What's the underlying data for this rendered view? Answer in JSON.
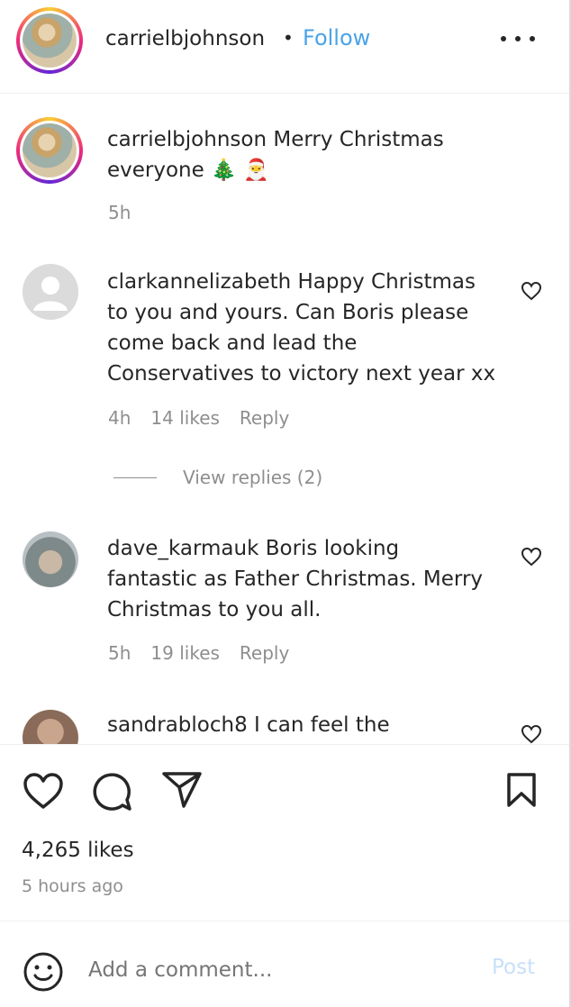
{
  "header": {
    "username": "carrielbjohnson",
    "separator": "•",
    "follow_label": "Follow"
  },
  "caption": {
    "username": "carrielbjohnson",
    "text": "Merry Christmas",
    "text2": "everyone 🎄 🎅",
    "time": "5h"
  },
  "comments": [
    {
      "username": "clarkannelizabeth",
      "line1": "Happy Christmas",
      "line2": "to you and yours. Can Boris please",
      "line3": "come back and lead the",
      "line4": "Conservatives to victory next year xx",
      "time": "4h",
      "likes": "14 likes",
      "reply": "Reply",
      "view_replies": "View replies (2)"
    },
    {
      "username": "dave_karmauk",
      "line1": "Boris looking",
      "line2": "fantastic as Father Christmas. Merry",
      "line3": "Christmas to you all.",
      "time": "5h",
      "likes": "19 likes",
      "reply": "Reply"
    },
    {
      "username": "sandrabloch8",
      "line1": "I can feel the"
    }
  ],
  "stats": {
    "likes": "4,265 likes",
    "time_ago": "5 hours ago"
  },
  "add_comment": {
    "placeholder": "Add a comment...",
    "post_label": "Post"
  },
  "colors": {
    "follow": "#4aa3e8",
    "post_disabled": "#c7e0f8",
    "meta": "#8e8e8e"
  },
  "icons": [
    "more-icon",
    "heart-icon",
    "comment-icon",
    "share-icon",
    "bookmark-icon",
    "emoji-icon"
  ]
}
